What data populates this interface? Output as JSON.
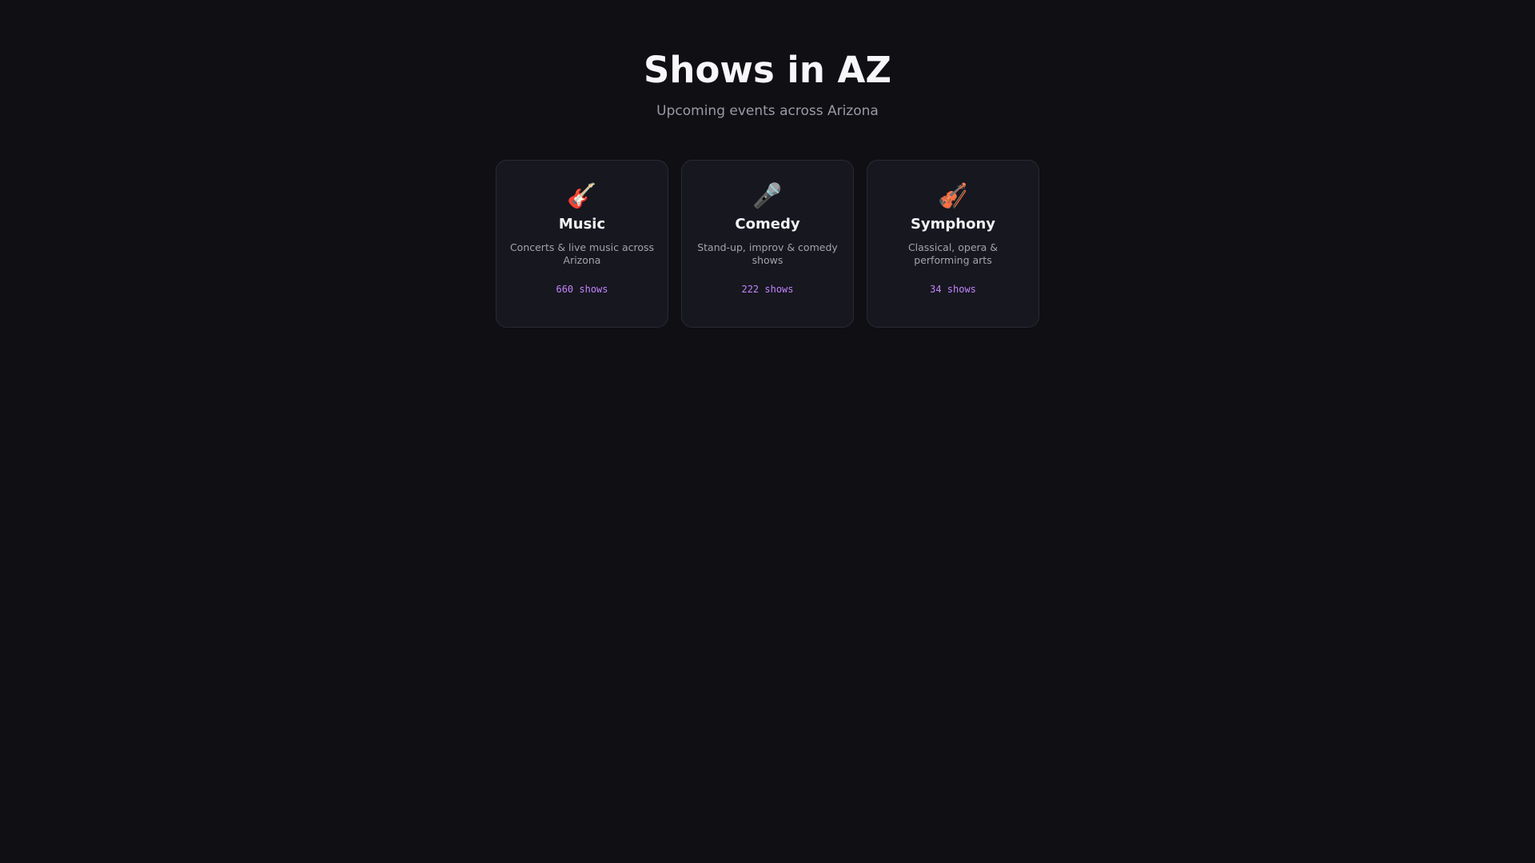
{
  "header": {
    "title": "Shows in AZ",
    "subtitle": "Upcoming events across Arizona"
  },
  "categories": [
    {
      "icon": "guitar-icon",
      "glyph": "🎸",
      "title": "Music",
      "description": "Concerts & live music across Arizona",
      "count": "660 shows"
    },
    {
      "icon": "microphone-icon",
      "glyph": "🎤",
      "title": "Comedy",
      "description": "Stand-up, improv & comedy shows",
      "count": "222 shows"
    },
    {
      "icon": "violin-icon",
      "glyph": "🎻",
      "title": "Symphony",
      "description": "Classical, opera & performing arts",
      "count": "34 shows"
    }
  ],
  "colors": {
    "background": "#0f0f14",
    "card": "#17171f",
    "accent": "#c084fc"
  }
}
